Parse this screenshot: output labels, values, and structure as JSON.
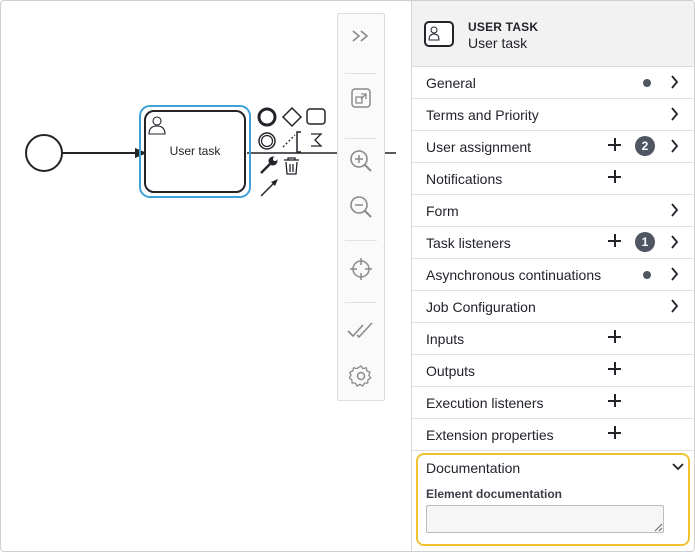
{
  "canvas": {
    "task": {
      "label": "User task"
    }
  },
  "toolbar": {
    "items": [
      {
        "icon": "double-chevron-right-icon"
      },
      {
        "icon": "fit-viewport-icon"
      },
      {
        "icon": "zoom-in-icon"
      },
      {
        "icon": "zoom-out-icon"
      },
      {
        "icon": "crosshair-icon"
      },
      {
        "icon": "double-check-icon"
      },
      {
        "icon": "gear-icon"
      }
    ]
  },
  "panel": {
    "header": {
      "type": "USER TASK",
      "name": "User task",
      "icon": "user-task-icon"
    },
    "groups": [
      {
        "label": "General",
        "dot": true,
        "chevron": true
      },
      {
        "label": "Terms and Priority",
        "chevron": true
      },
      {
        "label": "User assignment",
        "plus": true,
        "badge": "2",
        "chevron": true
      },
      {
        "label": "Notifications",
        "plus": true
      },
      {
        "label": "Form",
        "chevron": true
      },
      {
        "label": "Task listeners",
        "plus": true,
        "badge": "1",
        "chevron": true
      },
      {
        "label": "Asynchronous continuations",
        "dot": true,
        "chevron": true
      },
      {
        "label": "Job Configuration",
        "chevron": true
      },
      {
        "label": "Inputs",
        "plus": true
      },
      {
        "label": "Outputs",
        "plus": true
      },
      {
        "label": "Execution listeners",
        "plus": true
      },
      {
        "label": "Extension properties",
        "plus": true
      }
    ],
    "documentation": {
      "title": "Documentation",
      "field_label": "Element documentation",
      "value": "",
      "highlight_color": "#f1c232"
    }
  },
  "colors": {
    "selection": "#3ea3d8",
    "text": "#22242a",
    "badge": "#505562"
  }
}
